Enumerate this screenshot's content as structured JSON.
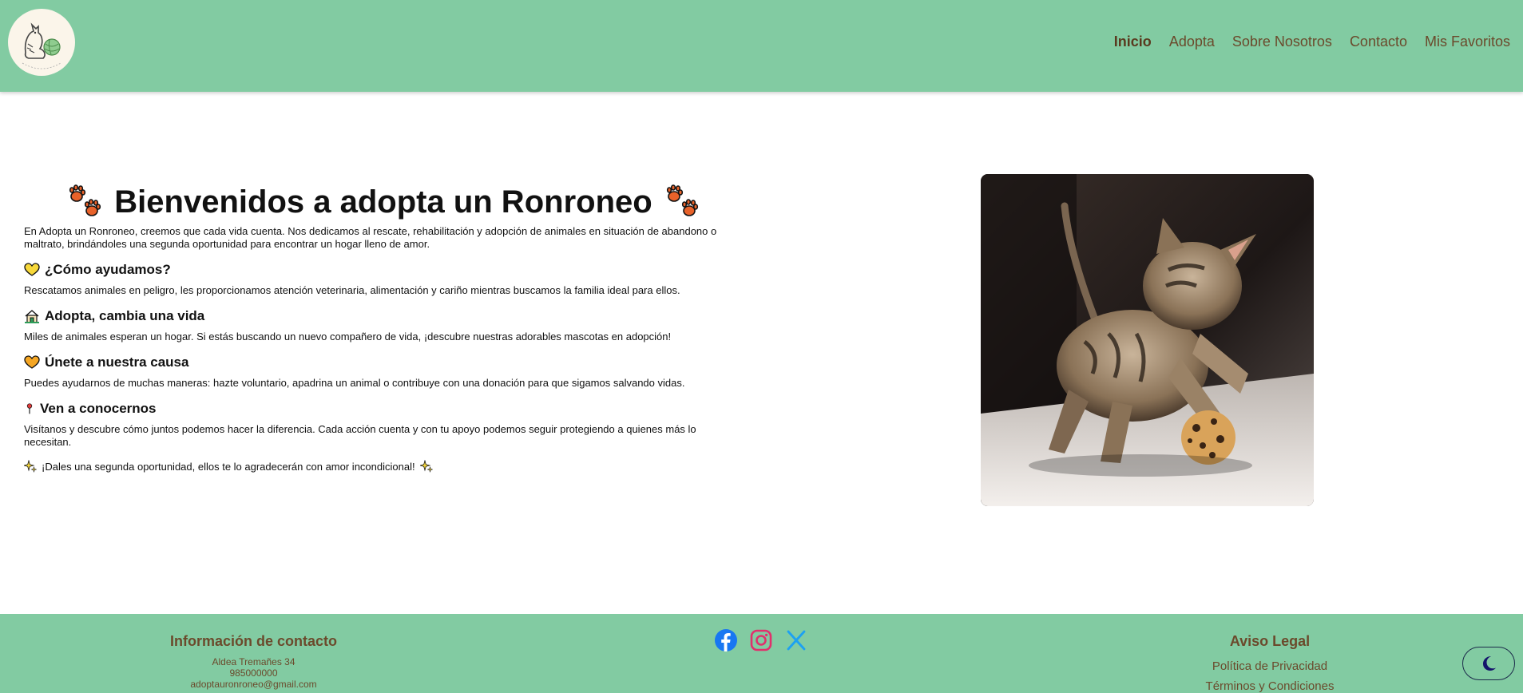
{
  "header": {
    "nav": [
      "Inicio",
      "Adopta",
      "Sobre Nosotros",
      "Contacto",
      "Mis Favoritos"
    ]
  },
  "hero": {
    "title": "Bienvenidos a adopta un Ronroneo",
    "intro": "En Adopta un Ronroneo, creemos que cada vida cuenta. Nos dedicamos al rescate, rehabilitación y adopción de animales en situación de abandono o maltrato, brindándoles una segunda oportunidad para encontrar un hogar lleno de amor."
  },
  "sections": [
    {
      "icon": "yellow-heart-icon",
      "heading": "¿Cómo ayudamos?",
      "text": "Rescatamos animales en peligro, les proporcionamos atención veterinaria, alimentación y cariño mientras buscamos la familia ideal para ellos."
    },
    {
      "icon": "house-icon",
      "heading": "Adopta, cambia una vida",
      "text": "Miles de animales esperan un hogar. Si estás buscando un nuevo compañero de vida, ¡descubre nuestras adorables mascotas en adopción!"
    },
    {
      "icon": "orange-heart-icon",
      "heading": "Únete a nuestra causa",
      "text": "Puedes ayudarnos de muchas maneras: hazte voluntario, apadrina un animal o contribuye con una donación para que sigamos salvando vidas."
    },
    {
      "icon": "pin-icon",
      "heading": "Ven a conocernos",
      "text": "Visítanos y descubre cómo juntos podemos hacer la diferencia. Cada acción cuenta y con tu apoyo podemos seguir protegiendo a quienes más lo necesitan."
    }
  ],
  "closing": "¡Dales una segunda oportunidad, ellos te lo agradecerán con amor incondicional!",
  "footer": {
    "contact_title": "Información de contacto",
    "address": "Aldea Tremañes 34",
    "phone": "985000000",
    "email": "adoptauronroneo@gmail.com",
    "legal_title": "Aviso Legal",
    "privacy": "Política de Privacidad",
    "terms": "Términos y Condiciones"
  },
  "colors": {
    "header_bg": "#82cba2",
    "nav_text": "#6b4a2c",
    "facebook": "#1877f2",
    "instagram": "#e1306c",
    "x": "#1da1f2"
  }
}
